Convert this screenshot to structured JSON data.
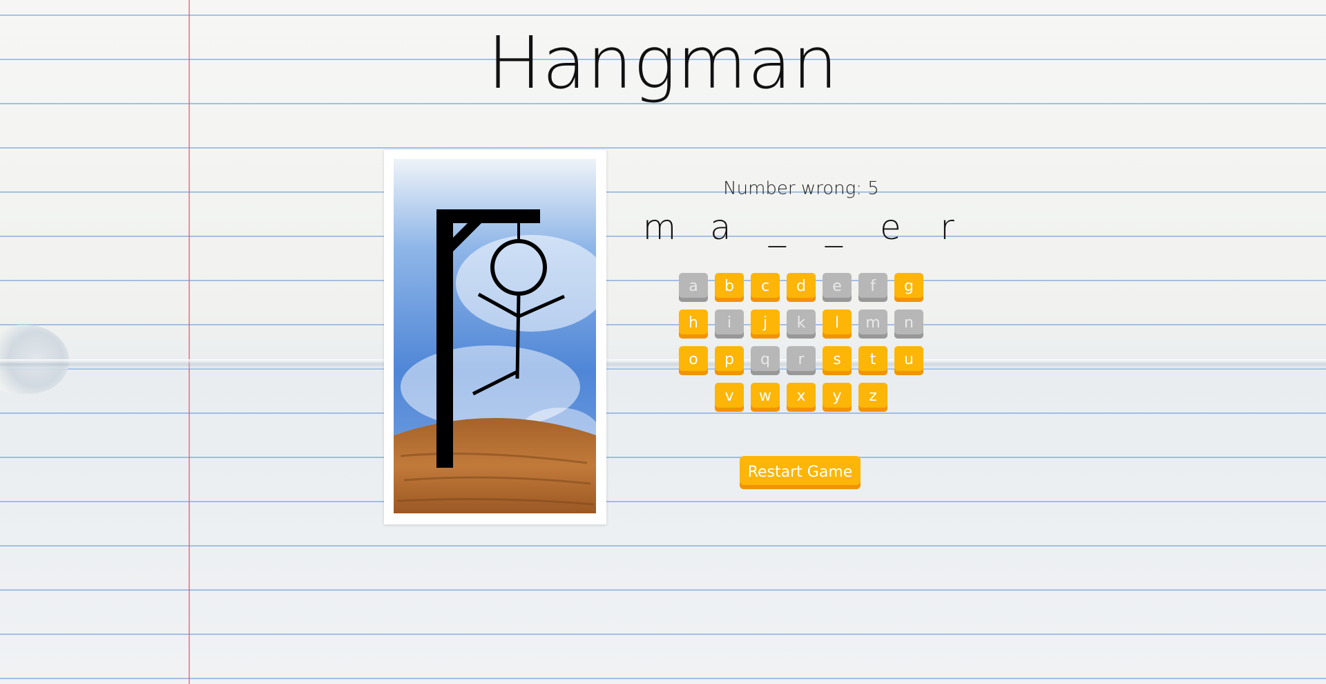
{
  "title": "Hangman",
  "status": {
    "number_wrong": "Number wrong: 5"
  },
  "word": [
    "m",
    "a",
    "_",
    "_",
    "e",
    "r"
  ],
  "keyboard": {
    "rows": [
      [
        {
          "letter": "a",
          "state": "used"
        },
        {
          "letter": "b",
          "state": "available"
        },
        {
          "letter": "c",
          "state": "available"
        },
        {
          "letter": "d",
          "state": "available"
        },
        {
          "letter": "e",
          "state": "used"
        },
        {
          "letter": "f",
          "state": "used"
        },
        {
          "letter": "g",
          "state": "available"
        }
      ],
      [
        {
          "letter": "h",
          "state": "available"
        },
        {
          "letter": "i",
          "state": "used"
        },
        {
          "letter": "j",
          "state": "available"
        },
        {
          "letter": "k",
          "state": "used"
        },
        {
          "letter": "l",
          "state": "available"
        },
        {
          "letter": "m",
          "state": "used"
        },
        {
          "letter": "n",
          "state": "used"
        }
      ],
      [
        {
          "letter": "o",
          "state": "available"
        },
        {
          "letter": "p",
          "state": "available"
        },
        {
          "letter": "q",
          "state": "used"
        },
        {
          "letter": "r",
          "state": "used"
        },
        {
          "letter": "s",
          "state": "available"
        },
        {
          "letter": "t",
          "state": "available"
        },
        {
          "letter": "u",
          "state": "available"
        }
      ],
      [
        {
          "letter": "v",
          "state": "available"
        },
        {
          "letter": "w",
          "state": "available"
        },
        {
          "letter": "x",
          "state": "available"
        },
        {
          "letter": "y",
          "state": "available"
        },
        {
          "letter": "z",
          "state": "available"
        }
      ]
    ]
  },
  "restart_label": "Restart Game",
  "hangman_image": {
    "icon": "hangman-gallows-icon",
    "stage": 5
  },
  "colors": {
    "key_available": "#fdb508",
    "key_used": "#b7b7b7",
    "sky": "#4f86d6",
    "ground": "#b76d2c"
  }
}
